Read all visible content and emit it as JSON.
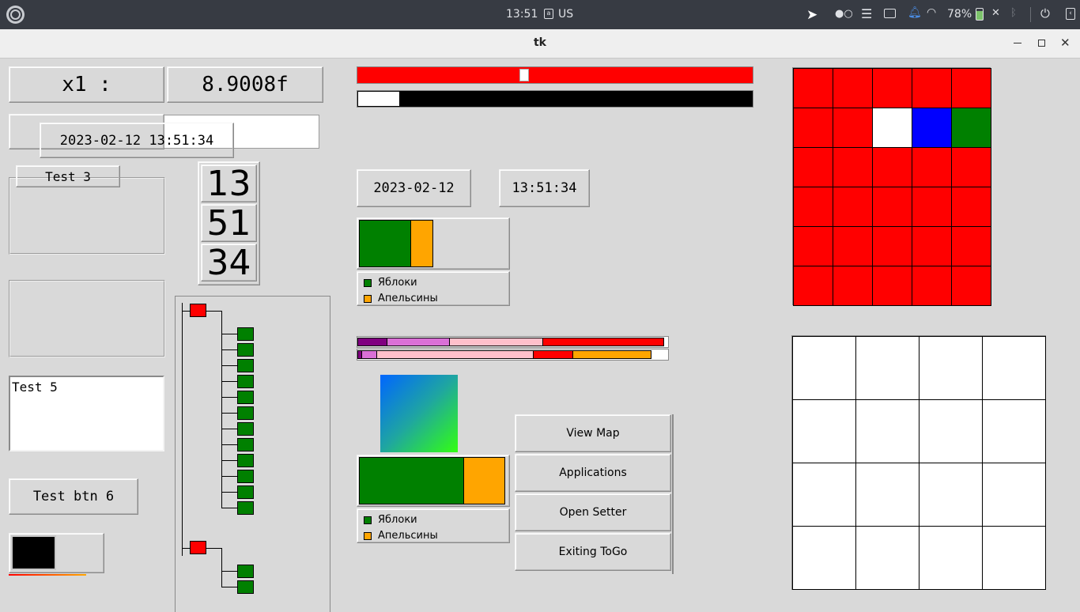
{
  "topbar": {
    "clock": "13:51",
    "keyboard_layout": "US",
    "battery": "78%"
  },
  "window": {
    "title": "tk"
  },
  "x1_label": "x1 :",
  "x1_value": "8.9008f",
  "datetime_overlay": "2023-02-12 13:51:34",
  "test3_label": "Test 3",
  "clock_digits": {
    "hours": "13",
    "minutes": "51",
    "seconds": "34"
  },
  "text_area": {
    "content": "Test 5"
  },
  "test_btn6": "Test btn 6",
  "date_value": "2023-02-12",
  "time_value": "13:51:34",
  "slider": {
    "value_fraction": 0.42,
    "color": "#ff0000"
  },
  "progress": {
    "value_fraction": 0.105
  },
  "legend": {
    "apples": "Яблоки",
    "oranges": "Апельсины"
  },
  "bar1": {
    "apples_fraction": 0.35,
    "oranges_fraction": 0.155
  },
  "bar2": {
    "apples_fraction": 0.71,
    "oranges_fraction": 0.28
  },
  "stack_bar_1": [
    {
      "color": "#800080",
      "fraction": 0.097
    },
    {
      "color": "#da70d6",
      "fraction": 0.204
    },
    {
      "color": "#ffc0cb",
      "fraction": 0.306
    },
    {
      "color": "#ff0000",
      "fraction": 0.393
    }
  ],
  "stack_bar_2": [
    {
      "color": "#800080",
      "fraction": 0.015
    },
    {
      "color": "#da70d6",
      "fraction": 0.051
    },
    {
      "color": "#ffc0cb",
      "fraction": 0.51
    },
    {
      "color": "#ff0000",
      "fraction": 0.13
    },
    {
      "color": "#ffa500",
      "fraction": 0.255
    }
  ],
  "menu": {
    "view_map": "View Map",
    "applications": "Applications",
    "open_setter": "Open Setter",
    "exiting": "Exiting ToGo"
  },
  "colors": {
    "red": "#ff0000",
    "green": "#008000",
    "orange": "#ffa500",
    "blue": "#0000ff",
    "white": "#ffffff"
  },
  "color_grid": {
    "rows": 6,
    "cols": 5,
    "cells": [
      [
        "#ff0000",
        "#ff0000",
        "#ff0000",
        "#ff0000",
        "#ff0000"
      ],
      [
        "#ff0000",
        "#ff0000",
        "#ffffff",
        "#0000ff",
        "#008000"
      ],
      [
        "#ff0000",
        "#ff0000",
        "#ff0000",
        "#ff0000",
        "#ff0000"
      ],
      [
        "#ff0000",
        "#ff0000",
        "#ff0000",
        "#ff0000",
        "#ff0000"
      ],
      [
        "#ff0000",
        "#ff0000",
        "#ff0000",
        "#ff0000",
        "#ff0000"
      ],
      [
        "#ff0000",
        "#ff0000",
        "#ff0000",
        "#ff0000",
        "#ff0000"
      ]
    ]
  },
  "white_grid": {
    "rows": 4,
    "cols": 4
  },
  "tree": {
    "groups": [
      {
        "children": 12
      },
      {
        "children": 2
      }
    ]
  }
}
